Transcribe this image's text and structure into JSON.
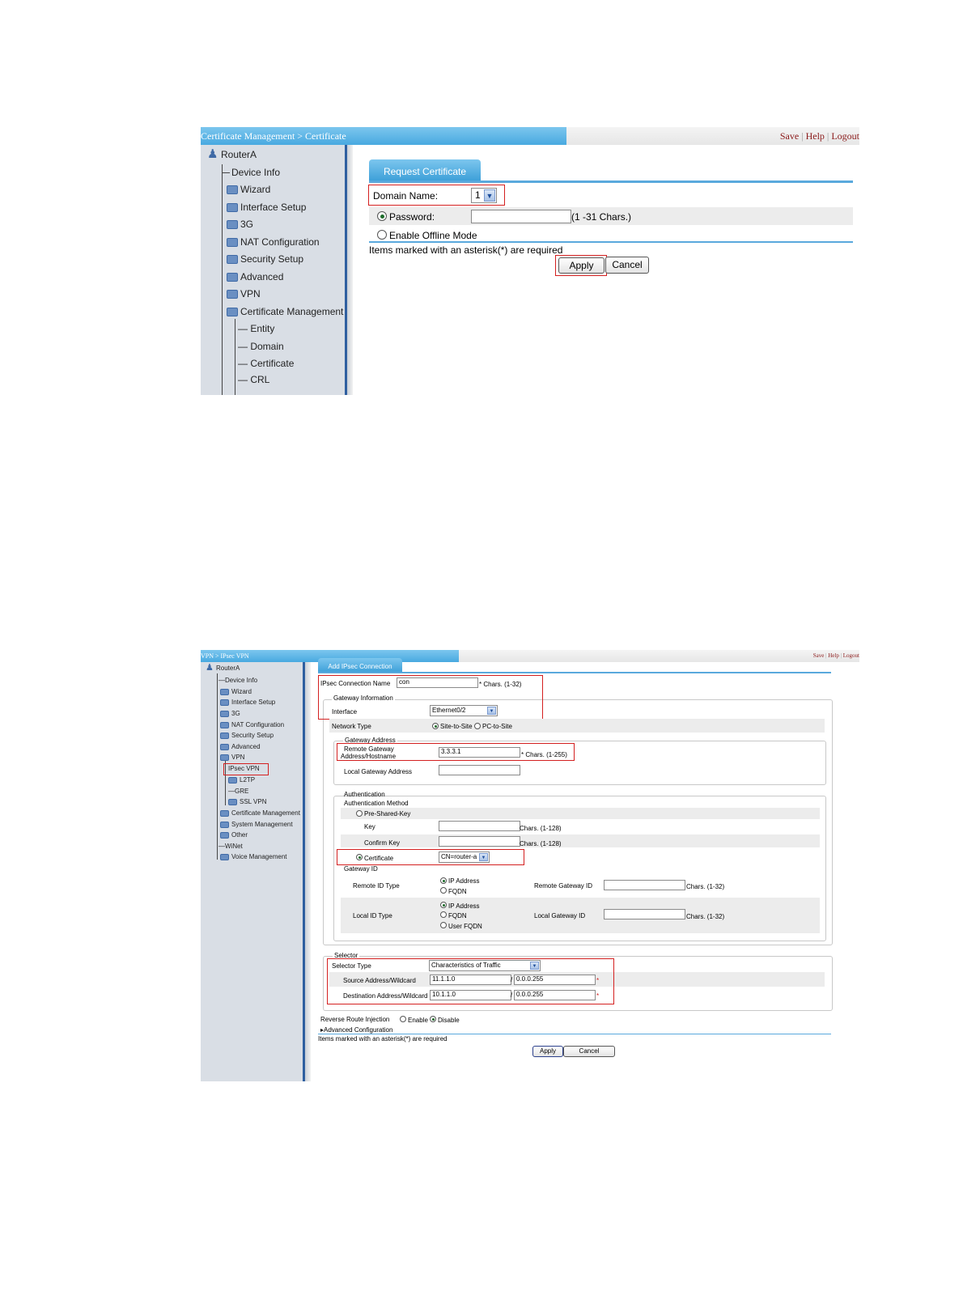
{
  "shot1": {
    "breadcrumb": "Certificate Management > Certificate",
    "links": {
      "save": "Save",
      "help": "Help",
      "logout": "Logout"
    },
    "sidebar": {
      "root": "RouterA",
      "items": [
        "Device Info",
        "Wizard",
        "Interface Setup",
        "3G",
        "NAT Configuration",
        "Security Setup",
        "Advanced",
        "VPN",
        "Certificate Management"
      ],
      "sub_items": [
        "Entity",
        "Domain",
        "Certificate",
        "CRL"
      ]
    },
    "tab": "Request Certificate",
    "domain_label": "Domain Name:",
    "domain_value": "1",
    "password_label": "Password:",
    "password_hint": "(1 -31 Chars.)",
    "offline_label": "Enable Offline Mode",
    "note": "Items marked with an asterisk(*) are required",
    "apply": "Apply",
    "cancel": "Cancel"
  },
  "shot2": {
    "breadcrumb": "VPN > IPsec VPN",
    "links": {
      "save": "Save",
      "help": "Help",
      "logout": "Logout"
    },
    "sidebar": {
      "root": "RouterA",
      "items": [
        "Device Info",
        "Wizard",
        "Interface Setup",
        "3G",
        "NAT Configuration",
        "Security Setup",
        "Advanced",
        "VPN"
      ],
      "vpn_items": [
        "IPsec VPN",
        "L2TP",
        "GRE",
        "SSL VPN"
      ],
      "tail_items": [
        "Certificate Management",
        "System Management",
        "Other",
        "WiNet",
        "Voice Management"
      ]
    },
    "tab": "Add IPsec Connection",
    "conn_name_label": "IPsec Connection Name",
    "conn_name_value": "con",
    "conn_name_hint": "* Chars. (1-32)",
    "gateway_info_legend": "Gateway Information",
    "interface_label": "Interface",
    "interface_value": "Ethernet0/2",
    "network_type_label": "Network Type",
    "site_to_site": "Site-to-Site",
    "pc_to_site": "PC-to-Site",
    "gateway_address_legend": "Gateway Address",
    "remote_gw_label_1": "Remote Gateway",
    "remote_gw_label_2": "Address/Hostname",
    "remote_gw_value": "3.3.3.1",
    "remote_gw_hint": "* Chars. (1-255)",
    "local_gw_label": "Local Gateway Address",
    "auth_legend": "Authentication",
    "auth_method_label": "Authentication Method",
    "psk_label": "Pre-Shared-Key",
    "key_label": "Key",
    "key_hint": "Chars. (1-128)",
    "confirm_key_label": "Confirm Key",
    "confirm_key_hint": "Chars. (1-128)",
    "certificate_label": "Certificate",
    "certificate_value": "CN=router-a",
    "gateway_id_legend": "Gateway ID",
    "remote_id_type_label": "Remote ID Type",
    "ip_address": "IP Address",
    "fqdn": "FQDN",
    "user_fqdn": "User FQDN",
    "remote_gw_id_label": "Remote Gateway ID",
    "remote_gw_id_hint": "Chars. (1-32)",
    "local_id_type_label": "Local ID Type",
    "local_gw_id_label": "Local Gateway ID",
    "local_gw_id_hint": "Chars. (1-32)",
    "selector_legend": "Selector",
    "selector_type_label": "Selector Type",
    "selector_type_value": "Characteristics of Traffic",
    "source_label": "Source Address/Wildcard",
    "source_addr": "11.1.1.0",
    "source_wild": "0.0.0.255",
    "dest_label": "Destination Address/Wildcard",
    "dest_addr": "10.1.1.0",
    "dest_wild": "0.0.0.255",
    "asterisk": "*",
    "slash": "/",
    "rri_label": "Reverse Route Injection",
    "enable": "Enable",
    "disable": "Disable",
    "advanced_config": "Advanced Configuration",
    "note": "Items marked with an asterisk(*) are required",
    "apply": "Apply",
    "cancel": "Cancel"
  }
}
